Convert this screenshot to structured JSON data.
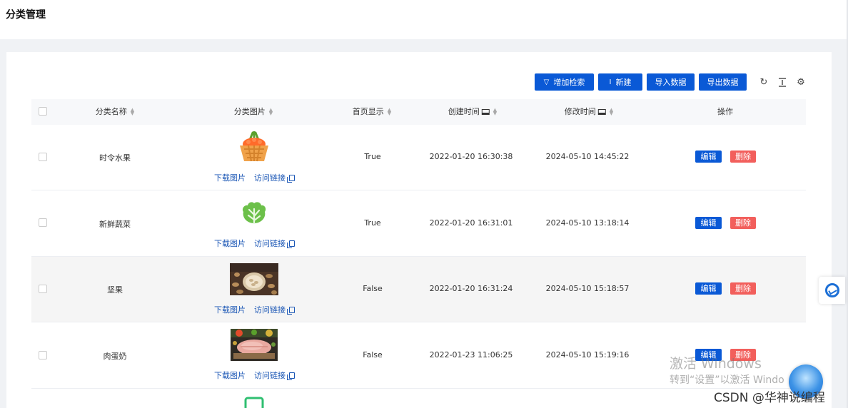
{
  "page": {
    "title": "分类管理"
  },
  "toolbar": {
    "filter_label": "增加检索",
    "new_label": "新建",
    "import_label": "导入数据",
    "export_label": "导出数据",
    "icons": [
      "reload-icon",
      "column-height-icon",
      "settings-icon"
    ]
  },
  "table": {
    "columns": [
      "分类名称",
      "分类图片",
      "首页显示",
      "创建时间",
      "修改时间",
      "操作"
    ],
    "download_label": "下载图片",
    "visit_label": "访问链接",
    "edit_label": "编辑",
    "delete_label": "删除",
    "rows": [
      {
        "name": "时令水果",
        "image": "fruit-basket-icon",
        "show_home": "True",
        "created": "2022-01-20 16:30:38",
        "modified": "2024-05-10 14:45:22"
      },
      {
        "name": "新鲜蔬菜",
        "image": "vegetable-icon",
        "show_home": "True",
        "created": "2022-01-20 16:31:01",
        "modified": "2024-05-10 13:18:14"
      },
      {
        "name": "坚果",
        "image": "nuts-photo",
        "show_home": "False",
        "created": "2022-01-20 16:31:24",
        "modified": "2024-05-10 15:18:57"
      },
      {
        "name": "肉蛋奶",
        "image": "meat-photo",
        "show_home": "False",
        "created": "2022-01-23 11:06:25",
        "modified": "2024-05-10 15:19:16"
      }
    ]
  },
  "watermark": {
    "activate_title": "激活 Windows",
    "activate_hint": "转到“设置”以激活 Windo",
    "csdn": "CSDN @华神说编程"
  }
}
